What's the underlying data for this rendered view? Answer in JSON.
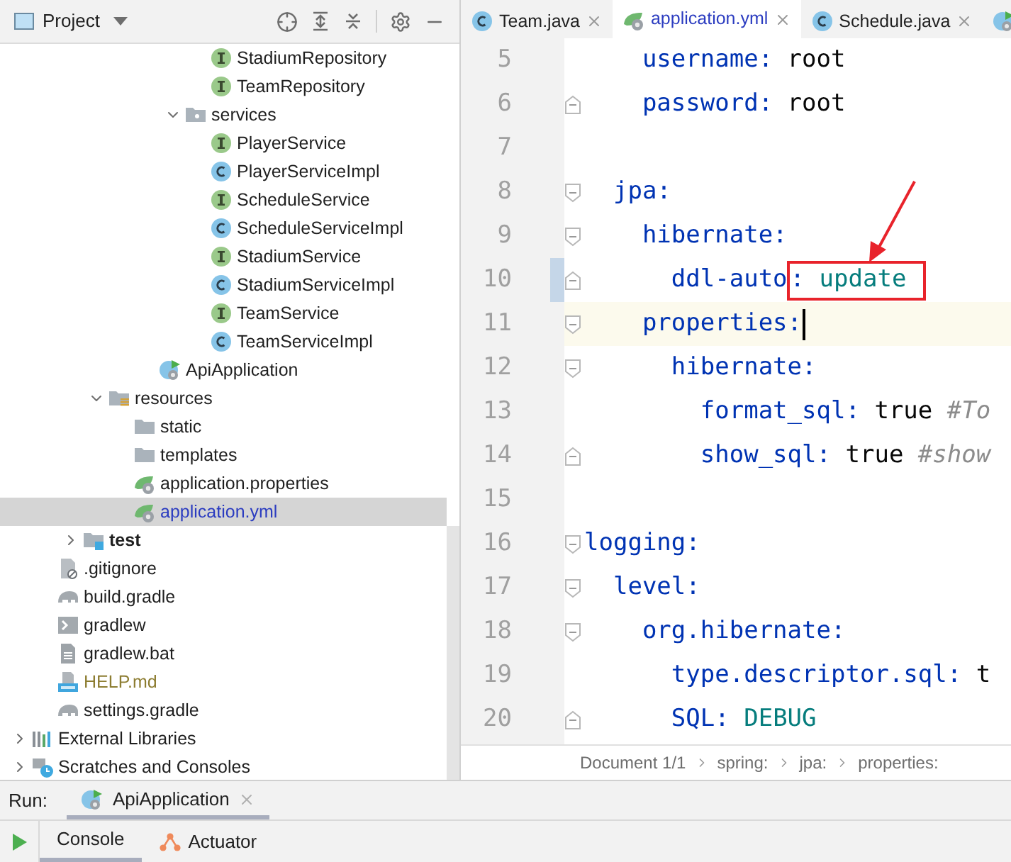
{
  "project_panel": {
    "title": "Project",
    "tree": [
      {
        "children": [
          {
            "children": [
              {
                "children": [
                  {
                    "children": [
                      {
                        "children": [
                          {
                            "children": [
                              {
                                "children": [
                                  {
                                    "label": "StadiumRepository",
                                    "kind": "interface",
                                    "selected": false
                                  },
                                  {
                                    "label": "TeamRepository",
                                    "kind": "interface",
                                    "selected": false
                                  }
                                ]
                              },
                              {
                                "label": "services",
                                "kind": "package",
                                "expanded": true,
                                "selected": false,
                                "children": [
                                  {
                                    "label": "PlayerService",
                                    "kind": "interface",
                                    "selected": false
                                  },
                                  {
                                    "label": "PlayerServiceImpl",
                                    "kind": "class",
                                    "selected": false
                                  },
                                  {
                                    "label": "ScheduleService",
                                    "kind": "interface",
                                    "selected": false
                                  },
                                  {
                                    "label": "ScheduleServiceImpl",
                                    "kind": "class",
                                    "selected": false
                                  },
                                  {
                                    "label": "StadiumService",
                                    "kind": "interface",
                                    "selected": false
                                  },
                                  {
                                    "label": "StadiumServiceImpl",
                                    "kind": "class",
                                    "selected": false
                                  },
                                  {
                                    "label": "TeamService",
                                    "kind": "interface",
                                    "selected": false
                                  },
                                  {
                                    "label": "TeamServiceImpl",
                                    "kind": "class",
                                    "selected": false
                                  }
                                ]
                              }
                            ]
                          },
                          {
                            "label": "ApiApplication",
                            "kind": "spring-app",
                            "selected": false
                          }
                        ]
                      }
                    ]
                  },
                  {
                    "label": "resources",
                    "kind": "resources",
                    "expanded": true,
                    "selected": false,
                    "children": [
                      {
                        "label": "static",
                        "kind": "folder",
                        "selected": false
                      },
                      {
                        "label": "templates",
                        "kind": "folder",
                        "selected": false
                      },
                      {
                        "label": "application.properties",
                        "kind": "spring-config",
                        "selected": false
                      },
                      {
                        "label": "application.yml",
                        "kind": "spring-config",
                        "selected": true
                      }
                    ]
                  }
                ]
              },
              {
                "label": "test",
                "kind": "test-folder",
                "expanded": false,
                "selected": false
              }
            ]
          },
          {
            "label": ".gitignore",
            "kind": "ignore-file",
            "selected": false,
            "ignored": false
          },
          {
            "label": "build.gradle",
            "kind": "gradle",
            "selected": false,
            "ignored": false
          },
          {
            "label": "gradlew",
            "kind": "script",
            "selected": false,
            "ignored": false
          },
          {
            "label": "gradlew.bat",
            "kind": "text",
            "selected": false,
            "ignored": false
          },
          {
            "label": "HELP.md",
            "kind": "markdown",
            "selected": false,
            "ignored": true
          },
          {
            "label": "settings.gradle",
            "kind": "gradle",
            "selected": false,
            "ignored": false
          }
        ]
      },
      {
        "label": "External Libraries",
        "kind": "libraries",
        "expanded": false,
        "selected": false
      },
      {
        "label": "Scratches and Consoles",
        "kind": "scratches",
        "expanded": false,
        "selected": false
      }
    ]
  },
  "editor_tabs": [
    {
      "label": "Team.java",
      "kind": "class",
      "selected": false
    },
    {
      "label": "application.yml",
      "kind": "spring-config",
      "selected": true
    },
    {
      "label": "Schedule.java",
      "kind": "class",
      "selected": false
    },
    {
      "kind": "spring-app",
      "selected": false
    }
  ],
  "editor": {
    "lines": [
      {
        "number": "5",
        "fold_start": false,
        "fold_end": false,
        "changed": false,
        "current": false,
        "annotated": false,
        "tokens": [
          {
            "kind": "key",
            "text": "    username:"
          },
          {
            "kind": "plain",
            "text": " root"
          }
        ]
      },
      {
        "number": "6",
        "fold_start": false,
        "fold_end": true,
        "changed": false,
        "current": false,
        "annotated": false,
        "tokens": [
          {
            "kind": "key",
            "text": "    password:"
          },
          {
            "kind": "plain",
            "text": " root"
          }
        ]
      },
      {
        "number": "7",
        "fold_start": false,
        "fold_end": false,
        "changed": false,
        "current": false,
        "annotated": false
      },
      {
        "number": "8",
        "fold_start": true,
        "fold_end": false,
        "changed": false,
        "current": false,
        "annotated": false,
        "tokens": [
          {
            "kind": "key",
            "text": "  jpa:"
          }
        ]
      },
      {
        "number": "9",
        "fold_start": true,
        "fold_end": false,
        "changed": false,
        "current": false,
        "annotated": false,
        "tokens": [
          {
            "kind": "key",
            "text": "    hibernate:"
          }
        ]
      },
      {
        "number": "10",
        "fold_start": false,
        "fold_end": true,
        "changed": true,
        "current": false,
        "annotated": true,
        "tokens": [
          {
            "kind": "key",
            "text": "      ddl-auto"
          },
          {
            "kind": "key",
            "text": ":"
          },
          {
            "kind": "enum",
            "text": " update"
          }
        ]
      },
      {
        "number": "11",
        "fold_start": true,
        "fold_end": false,
        "changed": false,
        "current": true,
        "annotated": false,
        "tokens": [
          {
            "kind": "key",
            "text": "    properties:"
          }
        ]
      },
      {
        "number": "12",
        "fold_start": true,
        "fold_end": false,
        "changed": false,
        "current": false,
        "annotated": false,
        "tokens": [
          {
            "kind": "key",
            "text": "      hibernate:"
          }
        ]
      },
      {
        "number": "13",
        "fold_start": false,
        "fold_end": false,
        "changed": false,
        "current": false,
        "annotated": false,
        "tokens": [
          {
            "kind": "key",
            "text": "        format_sql:"
          },
          {
            "kind": "plain",
            "text": " true "
          },
          {
            "kind": "comment",
            "text": "#To"
          }
        ]
      },
      {
        "number": "14",
        "fold_start": false,
        "fold_end": true,
        "changed": false,
        "current": false,
        "annotated": false,
        "tokens": [
          {
            "kind": "key",
            "text": "        show_sql:"
          },
          {
            "kind": "plain",
            "text": " true "
          },
          {
            "kind": "comment",
            "text": "#show"
          }
        ]
      },
      {
        "number": "15",
        "fold_start": false,
        "fold_end": false,
        "changed": false,
        "current": false,
        "annotated": false
      },
      {
        "number": "16",
        "fold_start": true,
        "fold_end": false,
        "changed": false,
        "current": false,
        "annotated": false,
        "tokens": [
          {
            "kind": "key",
            "text": "logging:"
          }
        ]
      },
      {
        "number": "17",
        "fold_start": true,
        "fold_end": false,
        "changed": false,
        "current": false,
        "annotated": false,
        "tokens": [
          {
            "kind": "key",
            "text": "  level:"
          }
        ]
      },
      {
        "number": "18",
        "fold_start": true,
        "fold_end": false,
        "changed": false,
        "current": false,
        "annotated": false,
        "tokens": [
          {
            "kind": "key",
            "text": "    org.hibernate:"
          }
        ]
      },
      {
        "number": "19",
        "fold_start": false,
        "fold_end": false,
        "changed": false,
        "current": false,
        "annotated": false,
        "tokens": [
          {
            "kind": "key",
            "text": "      type.descriptor.sql:"
          },
          {
            "kind": "plain",
            "text": " t"
          }
        ]
      },
      {
        "number": "20",
        "fold_start": false,
        "fold_end": true,
        "changed": false,
        "current": false,
        "annotated": false,
        "tokens": [
          {
            "kind": "key",
            "text": "      SQL:"
          },
          {
            "kind": "enum",
            "text": " DEBUG"
          }
        ]
      }
    ],
    "breadcrumbs": [
      "Document 1/1",
      "spring:",
      "jpa:",
      "properties:"
    ]
  },
  "run_panel": {
    "label": "Run:",
    "tabs": [
      {
        "label": "ApiApplication",
        "kind": "spring-app",
        "selected": true
      }
    ],
    "subtabs": [
      {
        "label": "Console",
        "kind": "console",
        "selected": true
      },
      {
        "label": "Actuator",
        "kind": "actuator",
        "selected": false
      }
    ]
  }
}
